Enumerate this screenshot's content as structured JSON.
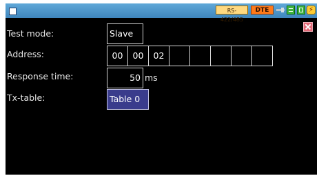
{
  "status_bar": {
    "interface": "RS-422/485",
    "dte": "DTE",
    "icons": [
      "window-icon",
      "plug-icon",
      "transfer-icon",
      "save-icon",
      "power-icon"
    ]
  },
  "form": {
    "test_mode": {
      "label": "Test mode:",
      "value": "Slave"
    },
    "address": {
      "label": "Address:",
      "cells": [
        "00",
        "00",
        "02",
        "",
        "",
        "",
        "",
        ""
      ]
    },
    "response_time": {
      "label": "Response time:",
      "value": "50",
      "unit": "ms"
    },
    "tx_table": {
      "label": "Tx-table:",
      "value": "Table 0"
    }
  },
  "colors": {
    "status_bar": "#4a96ca",
    "screen_bg": "#000000",
    "selected_field": "#3a3c8c",
    "close_button": "#e46a78",
    "dte_badge": "#ff7a1a",
    "interface_badge": "#ffd980"
  }
}
